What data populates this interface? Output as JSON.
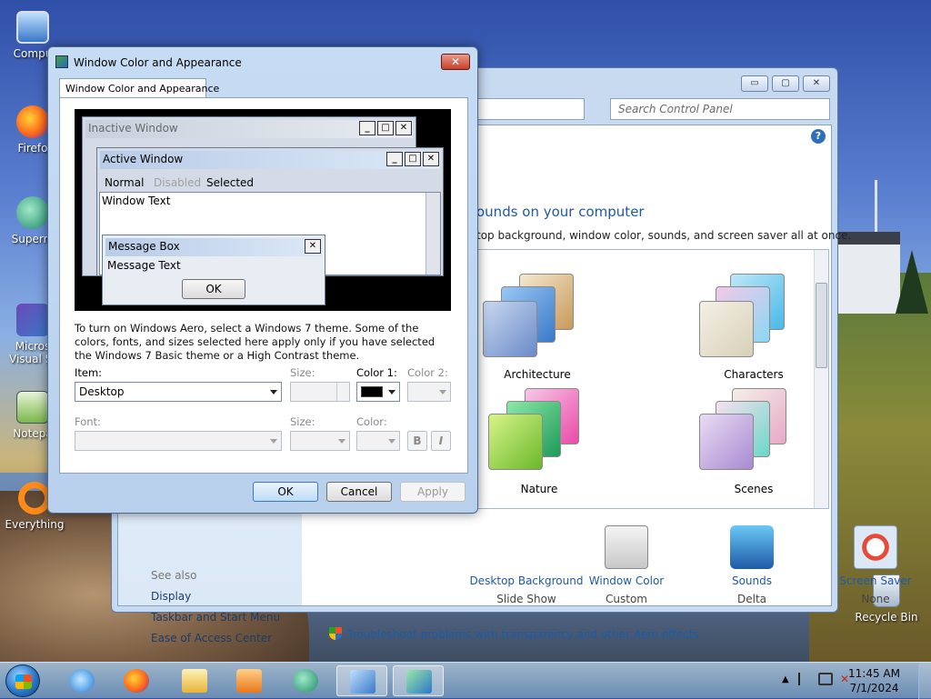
{
  "desktop": {
    "icons": [
      {
        "label": "Compu"
      },
      {
        "label": "Firefo"
      },
      {
        "label": "Superm"
      },
      {
        "label": "Micros"
      },
      {
        "label": "Visual St"
      },
      {
        "label": "Notepa"
      },
      {
        "label": "Everything"
      },
      {
        "label": "Recycle Bin"
      }
    ]
  },
  "control_panel": {
    "search_placeholder": "Search Control Panel",
    "heading": "ounds on your computer",
    "subheading": "top background, window color, sounds, and screen saver all at once.",
    "themes": [
      {
        "label": "Architecture"
      },
      {
        "label": "Characters"
      },
      {
        "label": "Nature"
      },
      {
        "label": "Scenes"
      }
    ],
    "tools": [
      {
        "name": "Desktop Background",
        "value": "Slide Show"
      },
      {
        "name": "Window Color",
        "value": "Custom"
      },
      {
        "name": "Sounds",
        "value": "Delta"
      },
      {
        "name": "Screen Saver",
        "value": "None"
      }
    ],
    "troubleshoot": "Troubleshoot problems with transparency and other Aero effects",
    "see_also": "See also",
    "side_links": [
      "Display",
      "Taskbar and Start Menu",
      "Ease of Access Center"
    ],
    "window_buttons": {
      "minimize": "▭",
      "maximize": "▢",
      "close": "✕"
    }
  },
  "dialog": {
    "title": "Window Color and Appearance",
    "tab": "Window Color and Appearance",
    "preview": {
      "inactive_title": "Inactive Window",
      "active_title": "Active Window",
      "menu": [
        "Normal",
        "Disabled",
        "Selected"
      ],
      "window_text": "Window Text",
      "message_box_title": "Message Box",
      "message_text": "Message Text",
      "ok": "OK"
    },
    "description": "To turn on Windows Aero, select a Windows 7 theme.  Some of the colors, fonts, and sizes selected here apply only if you have selected the Windows 7 Basic theme or a High Contrast theme.",
    "labels": {
      "item": "Item:",
      "size1": "Size:",
      "color1": "Color 1:",
      "color2": "Color 2:",
      "font": "Font:",
      "size2": "Size:",
      "color": "Color:"
    },
    "item_value": "Desktop",
    "color1_value": "#000000",
    "bold": "B",
    "italic": "I",
    "buttons": {
      "ok": "OK",
      "cancel": "Cancel",
      "apply": "Apply"
    }
  },
  "taskbar": {
    "time": "11:45 AM",
    "date": "7/1/2024"
  }
}
